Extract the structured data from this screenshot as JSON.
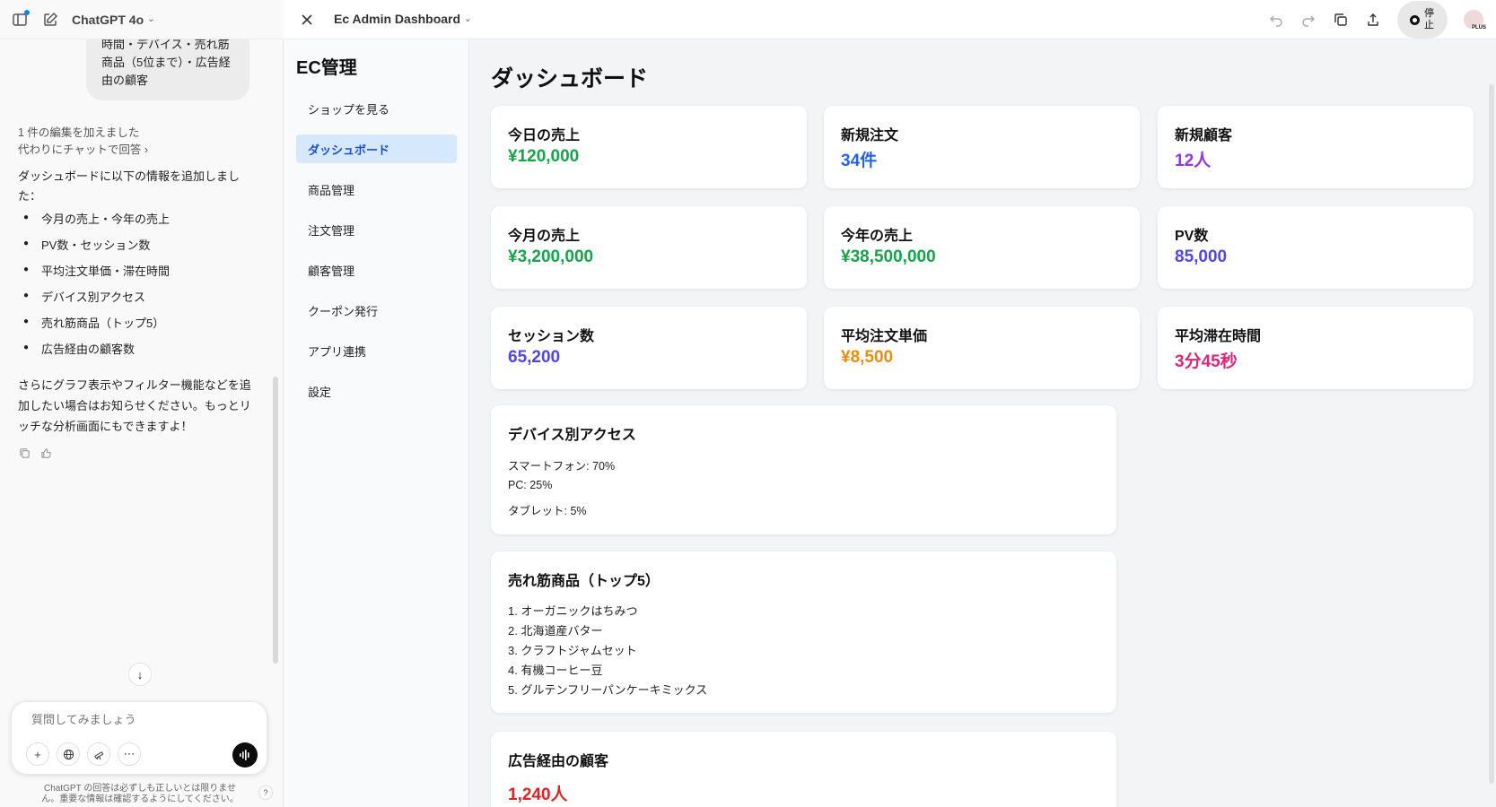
{
  "chat": {
    "model_name": "ChatGPT 4o",
    "user_bubble_lines": [
      "時間・デバイス・売れ筋",
      "商品（5位まで）・広告経",
      "由の顧客"
    ],
    "edit_note": "1 件の編集を加えました",
    "edit_link": "代わりにチャットで回答 ›",
    "assistant_intro_1": "ダッシュボードに以下の情報を追加しまし",
    "assistant_intro_2": "た：",
    "bullets": [
      "今月の売上・今年の売上",
      "PV数・セッション数",
      "平均注文単価・滞在時間",
      "デバイス別アクセス",
      "売れ筋商品（トップ5）",
      "広告経由の顧客数"
    ],
    "closing_1": "さらにグラフ表示やフィルター機能などを追",
    "closing_2": "加したい場合はお知らせください。もっとリ",
    "closing_3": "ッチな分析画面にもできますよ！",
    "composer_placeholder": "質問してみましょう",
    "disclaimer_1": "ChatGPT の回答は必ずしも正しいとは限りませ",
    "disclaimer_2": "ん。重要な情報は確認するようにしてください。",
    "help": "?"
  },
  "canvas": {
    "doc_title": "Ec Admin Dashboard",
    "stop_label": "停止",
    "avatar_badge": "PLUS"
  },
  "ec": {
    "title": "EC管理",
    "nav": [
      {
        "label": "ショップを見る",
        "active": false
      },
      {
        "label": "ダッシュボード",
        "active": true
      },
      {
        "label": "商品管理",
        "active": false
      },
      {
        "label": "注文管理",
        "active": false
      },
      {
        "label": "顧客管理",
        "active": false
      },
      {
        "label": "クーポン発行",
        "active": false
      },
      {
        "label": "アプリ連携",
        "active": false
      },
      {
        "label": "設定",
        "active": false
      }
    ]
  },
  "dashboard": {
    "title": "ダッシュボード",
    "stats": [
      {
        "label": "今日の売上",
        "value": "¥120,000",
        "color": "#16a34a"
      },
      {
        "label": "新規注文",
        "value": "34件",
        "color": "#2563eb"
      },
      {
        "label": "新規顧客",
        "value": "12人",
        "color": "#9333ea"
      },
      {
        "label": "今月の売上",
        "value": "¥3,200,000",
        "color": "#16a34a"
      },
      {
        "label": "今年の売上",
        "value": "¥38,500,000",
        "color": "#16a34a"
      },
      {
        "label": "PV数",
        "value": "85,000",
        "color": "#4f46e5"
      },
      {
        "label": "セッション数",
        "value": "65,200",
        "color": "#4f46e5"
      },
      {
        "label": "平均注文単価",
        "value": "¥8,500",
        "color": "#ea8c0c"
      },
      {
        "label": "平均滞在時間",
        "value": "3分45秒",
        "color": "#db2777"
      }
    ],
    "device": {
      "title": "デバイス別アクセス",
      "items": [
        "スマートフォン: 70%",
        "PC: 25%",
        "タブレット: 5%"
      ]
    },
    "top5": {
      "title": "売れ筋商品（トップ5）",
      "items": [
        "1. オーガニックはちみつ",
        "2. 北海道産バター",
        "3. クラフトジャムセット",
        "4. 有機コーヒー豆",
        "5. グルテンフリーパンケーキミックス"
      ]
    },
    "ads": {
      "title": "広告経由の顧客",
      "value": "1,240人",
      "color": "#dc2626"
    }
  }
}
